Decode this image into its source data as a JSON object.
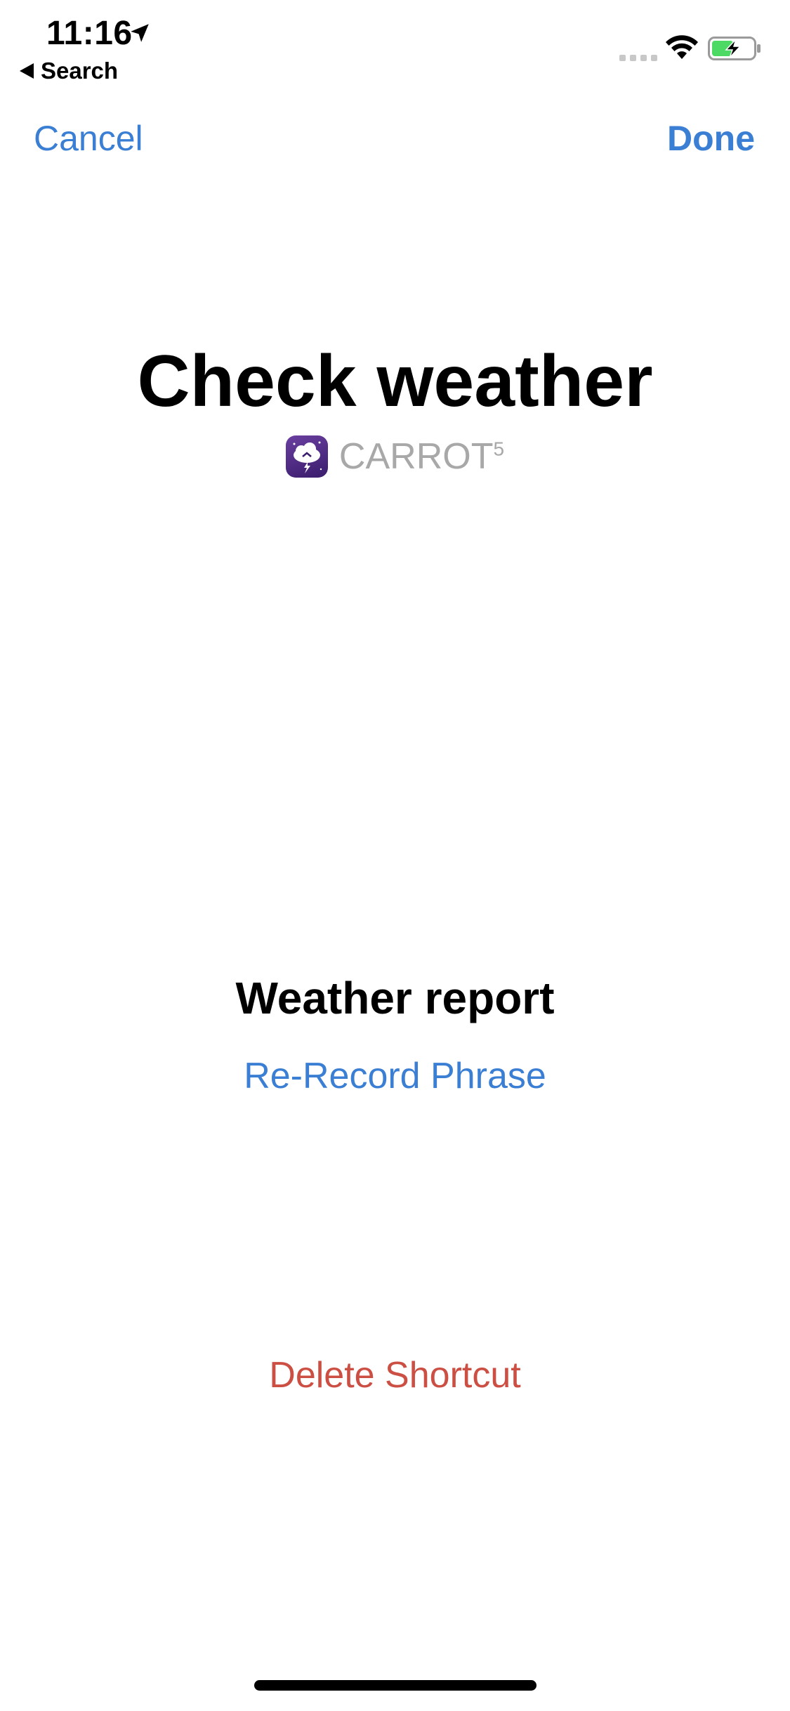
{
  "status_bar": {
    "time": "11:16",
    "back_app_label": "Search",
    "icons": [
      "location-arrow-icon",
      "cellular-signal-icon",
      "wifi-icon",
      "battery-charging-icon"
    ]
  },
  "nav": {
    "cancel_label": "Cancel",
    "done_label": "Done"
  },
  "shortcut": {
    "title": "Check weather",
    "app_name": "CARROT",
    "app_name_superscript": "5",
    "app_icon": "carrot-weather-app-icon",
    "phrase": "Weather report",
    "rerecord_label": "Re-Record Phrase",
    "delete_label": "Delete Shortcut"
  },
  "colors": {
    "accent": "#3b7fd4",
    "destructive": "#cc4f44",
    "secondary_text": "#a8a8a8",
    "battery_fill": "#4cd964"
  }
}
